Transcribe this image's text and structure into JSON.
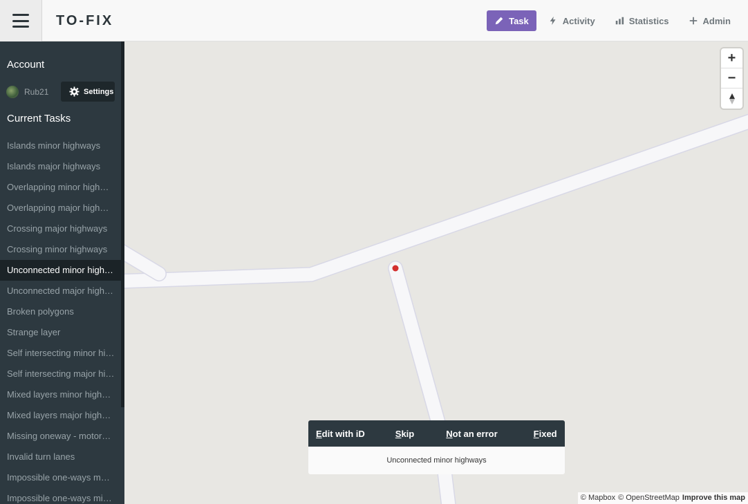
{
  "header": {
    "logo": "TO-FIX",
    "nav": [
      {
        "label": "Task",
        "icon": "pencil-icon",
        "active": true
      },
      {
        "label": "Activity",
        "icon": "bolt-icon",
        "active": false
      },
      {
        "label": "Statistics",
        "icon": "bar-chart-icon",
        "active": false
      },
      {
        "label": "Admin",
        "icon": "plus-icon",
        "active": false
      }
    ]
  },
  "sidebar": {
    "account_heading": "Account",
    "username": "Rub21",
    "settings_label": "Settings",
    "tasks_heading": "Current Tasks",
    "tasks": [
      "Islands minor highways",
      "Islands major highways",
      "Overlapping minor highways",
      "Overlapping major highways",
      "Crossing major highways",
      "Crossing minor highways",
      "Unconnected minor highways",
      "Unconnected major highways",
      "Broken polygons",
      "Strange layer",
      "Self intersecting minor highways",
      "Self intersecting major highways",
      "Mixed layers minor highways",
      "Mixed layers major highways",
      "Missing oneway - motorways",
      "Invalid turn lanes",
      "Impossible one-ways major",
      "Impossible one-ways minor"
    ],
    "active_task_index": 6
  },
  "map": {
    "zoom_in": "+",
    "zoom_out": "−",
    "attribution_mapbox": "© Mapbox",
    "attribution_osm": "© OpenStreetMap",
    "improve_link": "Improve this map"
  },
  "action_panel": {
    "buttons": [
      {
        "key": "E",
        "rest": "dit with iD"
      },
      {
        "key": "S",
        "rest": "kip"
      },
      {
        "key": "N",
        "rest": "ot an error"
      },
      {
        "key": "F",
        "rest": "ixed"
      }
    ],
    "task_label": "Unconnected minor highways"
  },
  "colors": {
    "accent": "#7b63b8",
    "sidebar": "#2d3940",
    "error_marker": "#d32f2f"
  }
}
